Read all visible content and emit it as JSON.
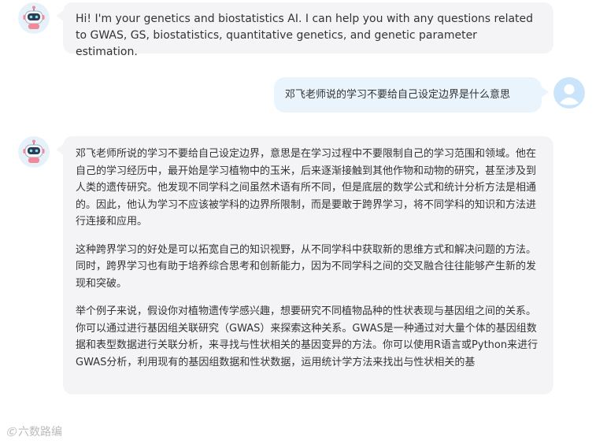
{
  "conversation": {
    "messages": [
      {
        "role": "assistant",
        "avatar_icon": "robot-icon",
        "text": "Hi! I'm your genetics and biostatistics AI. I can help you with any questions related to GWAS, GS, biostatistics, quantitative genetics, and genetic parameter estimation."
      },
      {
        "role": "user",
        "avatar_icon": "user-avatar-icon",
        "text": "邓飞老师说的学习不要给自己设定边界是什么意思"
      },
      {
        "role": "assistant",
        "avatar_icon": "robot-icon",
        "paragraphs": [
          "邓飞老师所说的学习不要给自己设定边界，意思是在学习过程中不要限制自己的学习范围和领域。他在自己的学习经历中，最开始是学习植物中的玉米，后来逐渐接触到其他作物和动物的研究，甚至涉及到人类的遗传研究。他发现不同学科之间虽然术语有所不同，但是底层的数学公式和统计分析方法是相通的。因此，他认为学习不应该被学科的边界所限制，而是要敢于跨界学习，将不同学科的知识和方法进行连接和应用。",
          "这种跨界学习的好处是可以拓宽自己的知识视野，从不同学科中获取新的思维方式和解决问题的方法。同时，跨界学习也有助于培养综合思考和创新能力，因为不同学科之间的交叉融合往往能够产生新的发现和突破。",
          "举个例子来说，假设你对植物遗传学感兴趣，想要研究不同植物品种的性状表现与基因组之间的关系。你可以通过进行基因组关联研究（GWAS）来探索这种关系。GWAS是一种通过对大量个体的基因组数据和表型数据进行关联分析，来寻找与性状相关的基因变异的方法。你可以使用R语言或Python来进行GWAS分析，利用现有的基因组数据和性状数据，运用统计学方法来找出与性状相关的基"
        ]
      }
    ]
  },
  "watermark": {
    "logo_text": "Ⓒ",
    "text": "六数路编"
  },
  "colors": {
    "assistant_bubble": "#f4f4f6",
    "user_bubble": "#e9f4fd",
    "text": "#333333",
    "user_avatar": "#c9e4fb"
  }
}
